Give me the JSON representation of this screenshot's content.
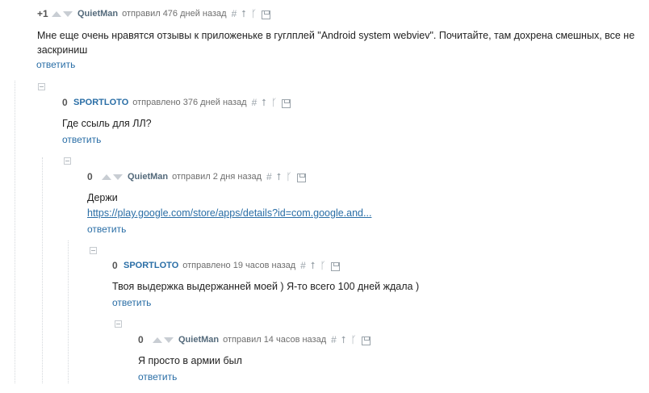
{
  "comments": [
    {
      "rating": "+1",
      "author": "QuietMan",
      "date": "отправил 476 дней назад",
      "text": "Мне еще очень нравятся отзывы к приложеньке в гуглплей \"Android system webviev\". Почитайте, там дохрена смешных, все не заскриниш",
      "reply": "ответить"
    },
    {
      "rating": "0",
      "author": "SPORTLOTO",
      "date": "отправлено 376 дней назад",
      "text": "Где ссыль для ЛЛ?",
      "reply": "ответить"
    },
    {
      "rating": "0",
      "author": "QuietMan",
      "date": "отправил 2 дня назад",
      "text": "Держи",
      "link": "https://play.google.com/store/apps/details?id=com.google.and...",
      "reply": "ответить"
    },
    {
      "rating": "0",
      "author": "SPORTLOTO",
      "date": "отправлено 19 часов назад",
      "text": "Твоя выдержка выдержанней моей ) Я-то всего 100 дней ждала )",
      "reply": "ответить"
    },
    {
      "rating": "0",
      "author": "QuietMan",
      "date": "отправил 14 часов назад",
      "text": "Я просто в армии был",
      "reply": "ответить"
    }
  ],
  "icons": {
    "hash": "#",
    "up": "⭡",
    "branch": "ᚴ"
  }
}
